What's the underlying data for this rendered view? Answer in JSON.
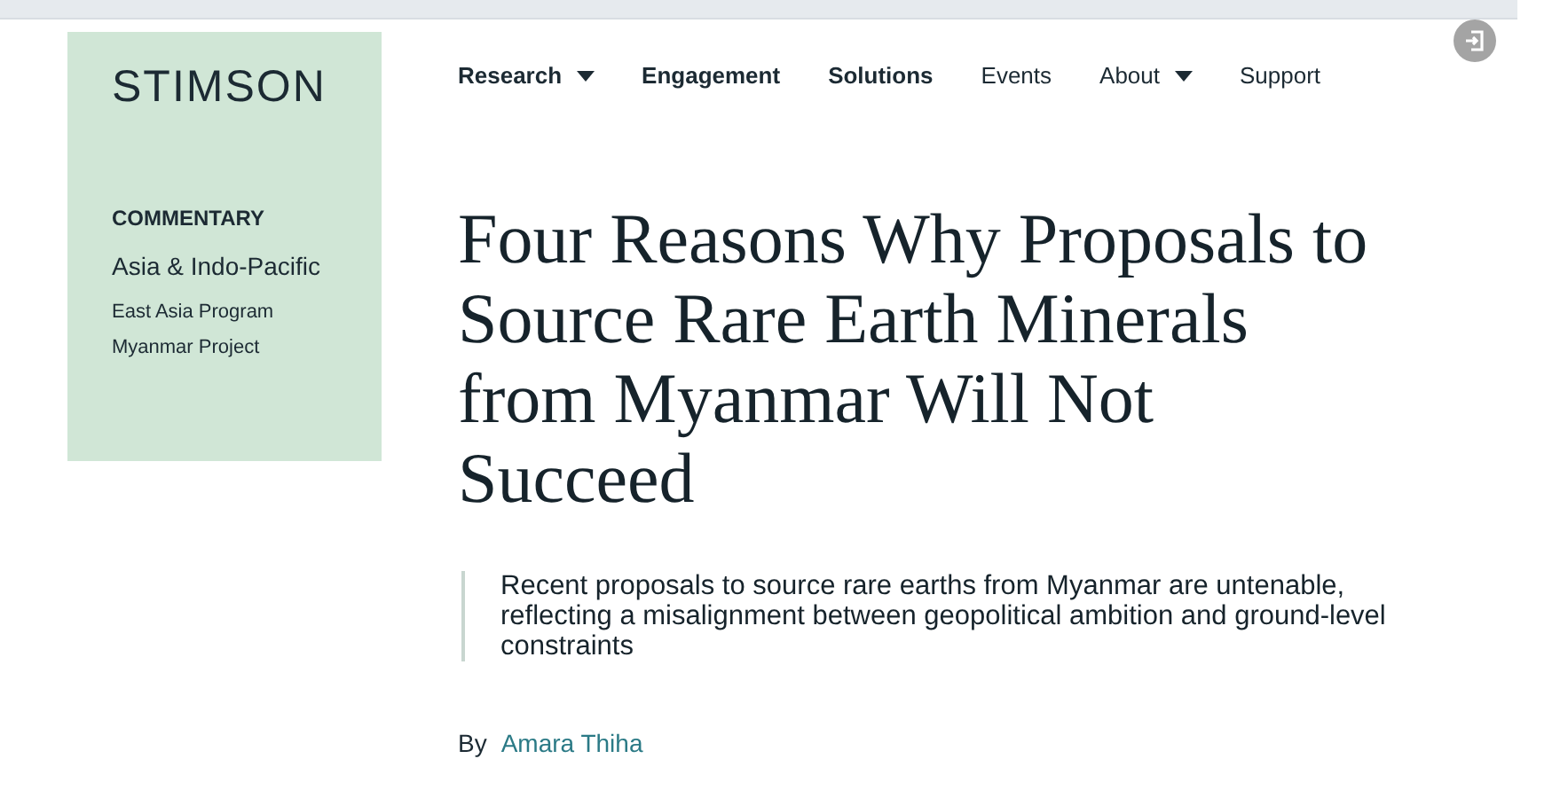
{
  "logo": "STIMSON",
  "nav": [
    {
      "label": "Research",
      "bold": true,
      "dropdown": true
    },
    {
      "label": "Engagement",
      "bold": true,
      "dropdown": false
    },
    {
      "label": "Solutions",
      "bold": true,
      "dropdown": false
    },
    {
      "label": "Events",
      "bold": false,
      "dropdown": false
    },
    {
      "label": "About",
      "bold": false,
      "dropdown": true
    },
    {
      "label": "Support",
      "bold": false,
      "dropdown": false
    }
  ],
  "sidebar": {
    "type": "COMMENTARY",
    "region": "Asia & Indo-Pacific",
    "programs": [
      "East Asia Program",
      "Myanmar Project"
    ]
  },
  "title": "Four Reasons Why Proposals to Source Rare Earth Minerals from Myanmar Will Not Succeed",
  "summary": "Recent proposals to source rare earths from Myanmar are untenable, reflecting a misalignment between geopolitical ambition and ground-level constraints",
  "byline": {
    "prefix": "By",
    "author": "Amara Thiha"
  }
}
